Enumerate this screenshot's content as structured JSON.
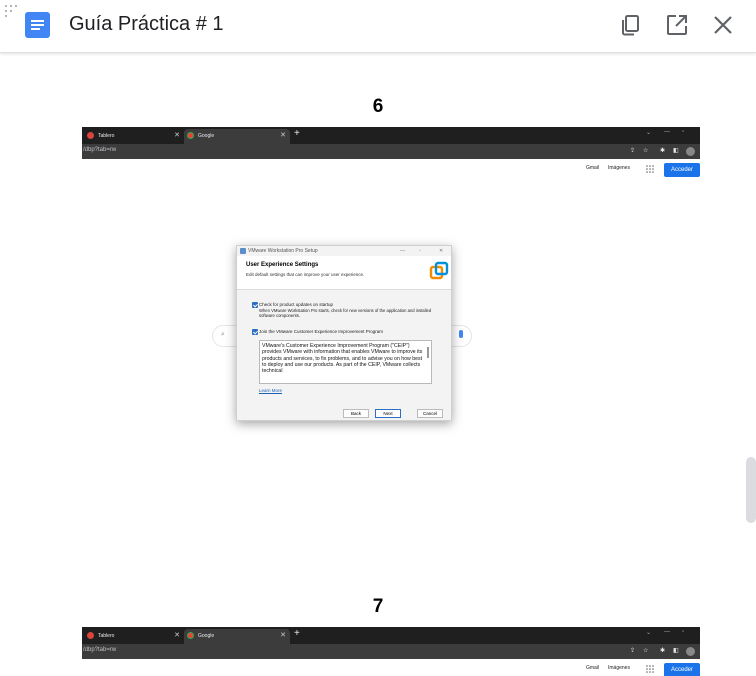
{
  "app": {
    "title": "Guía Práctica # 1"
  },
  "toolbar": {
    "icons": [
      "copy-icon",
      "open-in-new-icon",
      "close-icon"
    ]
  },
  "pages": [
    {
      "number": "6",
      "browser": {
        "tabs": [
          "Tablero",
          "Google"
        ],
        "url": "/dbp?tab=rw",
        "links": [
          "Gmail",
          "Imágenes"
        ],
        "signin": "Acceder"
      },
      "dialog": {
        "title": "VMware Workstation Pro Setup",
        "heading": "User Experience Settings",
        "subtitle": "Edit default settings that can improve your user experience.",
        "check1_label": "Check for product updates on startup",
        "check1_desc": "When VMware Workstation Pro starts, check for new versions of the application and installed software components.",
        "check2_label": "Join the VMware Customer Experience Improvement Program",
        "ceip_text": "VMware's Customer Experience Improvement Program (\"CEIP\") provides VMware with information that enables VMware to improve its products and services, to fix problems, and to advise you on how best to deploy and use our products. As part of the CEIP, VMware collects technical",
        "learn_more": "Learn More",
        "buttons": {
          "back": "Back",
          "next": "Next",
          "cancel": "Cancel"
        }
      }
    },
    {
      "number": "7",
      "browser": {
        "tabs": [
          "Tablero",
          "Google"
        ],
        "url": "/dbp?tab=rw",
        "links": [
          "Gmail",
          "Imágenes"
        ],
        "signin": "Acceder"
      }
    }
  ],
  "colors": {
    "docs_blue": "#4285f4",
    "signin_blue": "#1a73e8",
    "tabbar": "#1f1f1f"
  }
}
